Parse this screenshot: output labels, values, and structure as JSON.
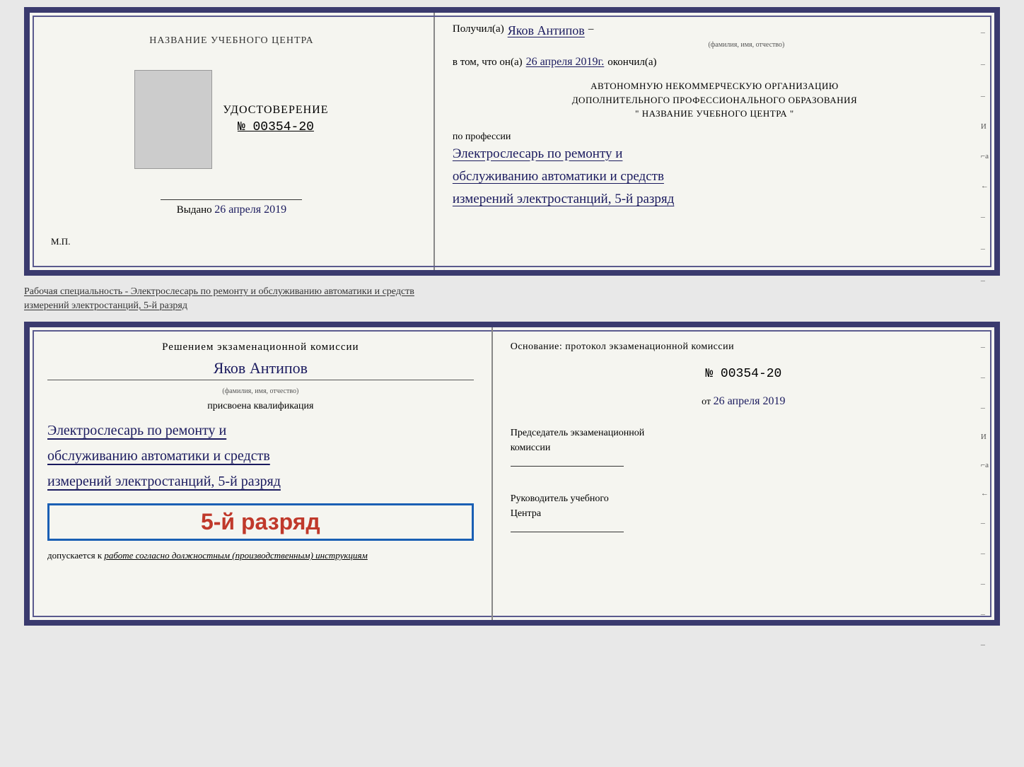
{
  "top_doc": {
    "left": {
      "training_center": "НАЗВАНИЕ УЧЕБНОГО ЦЕНТРА",
      "udostoverenie": "УДОСТОВЕРЕНИЕ",
      "number": "№ 00354-20",
      "vydano_label": "Выдано",
      "vydano_date": "26 апреля 2019",
      "mp": "М.П."
    },
    "right": {
      "poluchil_label": "Получил(а)",
      "fio_value": "Яков Антипов",
      "fio_caption": "(фамилия, имя, отчество)",
      "dash": "–",
      "vtom_prefix": "в том, что он(а)",
      "vtom_date": "26 апреля 2019г.",
      "vtom_suffix": "окончил(а)",
      "org_line1": "АВТОНОМНУЮ НЕКОММЕРЧЕСКУЮ ОРГАНИЗАЦИЮ",
      "org_line2": "ДОПОЛНИТЕЛЬНОГО ПРОФЕССИОНАЛЬНОГО ОБРАЗОВАНИЯ",
      "org_quotes": "\"",
      "org_name": "НАЗВАНИЕ УЧЕБНОГО ЦЕНТРА",
      "po_professii": "по профессии",
      "profession_line1": "Электрослесарь по ремонту и",
      "profession_line2": "обслуживанию автоматики и средств",
      "profession_line3": "измерений электростанций, 5-й разряд"
    }
  },
  "info_text": {
    "line1": "Рабочая специальность - Электрослесарь по ремонту и обслуживанию автоматики и средств",
    "line2": "измерений электростанций, 5-й разряд"
  },
  "bottom_doc": {
    "left": {
      "resheniem": "Решением экзаменационной комиссии",
      "fio": "Яков Антипов",
      "fio_caption": "(фамилия, имя, отчество)",
      "prisvoena": "присвоена квалификация",
      "qual_line1": "Электрослесарь по ремонту и",
      "qual_line2": "обслуживанию автоматики и средств",
      "qual_line3": "измерений электростанций, 5-й разряд",
      "razryad_badge": "5-й разряд",
      "dopuskaetsya": "допускается к",
      "dopuskaetsya_rest": "работе согласно должностным (производственным) инструкциям"
    },
    "right": {
      "osnovanie": "Основание: протокол экзаменационной комиссии",
      "number": "№ 00354-20",
      "ot_label": "от",
      "ot_date": "26 апреля 2019",
      "predsedatel_line1": "Председатель экзаменационной",
      "predsedatel_line2": "комиссии",
      "rukovoditel_line1": "Руководитель учебного",
      "rukovoditel_line2": "Центра"
    }
  }
}
